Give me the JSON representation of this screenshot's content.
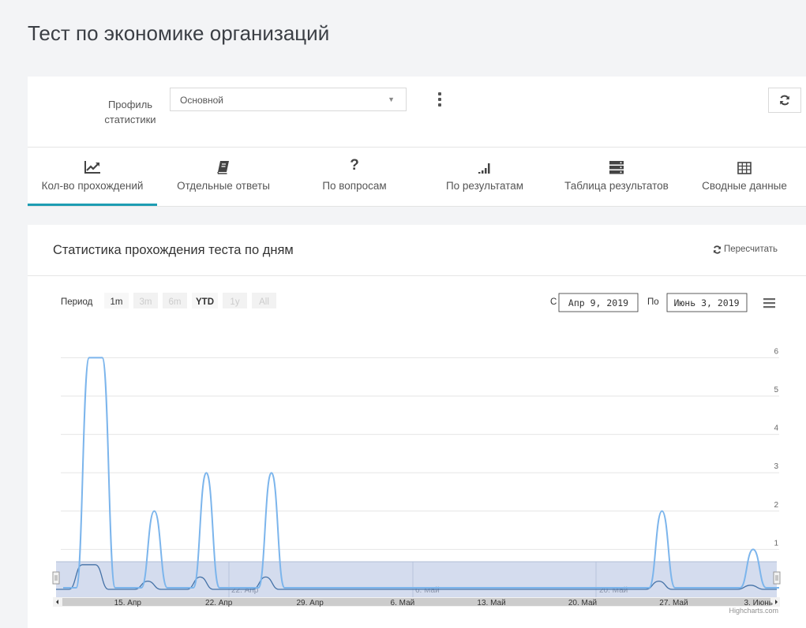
{
  "page": {
    "title": "Тест по экономике организаций"
  },
  "profile": {
    "label_line1": "Профиль",
    "label_line2": "статистики",
    "selected": "Основной"
  },
  "tabs": [
    {
      "label": "Кол-во прохождений",
      "icon": "line-chart-icon",
      "active": true
    },
    {
      "label": "Отдельные ответы",
      "icon": "book-icon",
      "active": false
    },
    {
      "label": "По вопросам",
      "icon": "question-icon",
      "active": false
    },
    {
      "label": "По результатам",
      "icon": "bar-signal-icon",
      "active": false
    },
    {
      "label": "Таблица результатов",
      "icon": "server-table-icon",
      "active": false
    },
    {
      "label": "Сводные данные",
      "icon": "grid-table-icon",
      "active": false
    }
  ],
  "stats": {
    "title": "Статистика прохождения теста по дням",
    "recalc_label": "Пересчитать"
  },
  "range_selector": {
    "period_label": "Период",
    "buttons": [
      {
        "label": "1m",
        "enabled": true
      },
      {
        "label": "3m",
        "enabled": false
      },
      {
        "label": "6m",
        "enabled": false
      },
      {
        "label": "YTD",
        "enabled": true
      },
      {
        "label": "1y",
        "enabled": false
      },
      {
        "label": "All",
        "enabled": false
      }
    ],
    "from_label": "С",
    "from_value": "Апр 9, 2019",
    "to_label": "По",
    "to_value": "Июнь 3, 2019"
  },
  "credits": "Highcharts.com",
  "colors": {
    "accent": "#1d9db3",
    "series": "#7cb5ec",
    "navigator_fill": "#ccd6eb",
    "navigator_line": "#4572a7"
  },
  "chart_data": {
    "type": "line",
    "x_range": [
      "2019-04-09",
      "2019-06-03"
    ],
    "y_ticks": [
      1,
      2,
      3,
      4,
      5,
      6
    ],
    "x_ticks": [
      "15. Апр",
      "22. Апр",
      "29. Апр",
      "6. Май",
      "13. Май",
      "20. Май",
      "27. Май",
      "3. Июнь"
    ],
    "navigator_labels": [
      "22. Апр",
      "6. Май",
      "20. Май"
    ],
    "points": [
      {
        "x": "2019-04-09",
        "y": 0
      },
      {
        "x": "2019-04-10",
        "y": 0
      },
      {
        "x": "2019-04-11",
        "y": 6
      },
      {
        "x": "2019-04-12",
        "y": 6
      },
      {
        "x": "2019-04-13",
        "y": 0
      },
      {
        "x": "2019-04-14",
        "y": 0
      },
      {
        "x": "2019-04-15",
        "y": 0
      },
      {
        "x": "2019-04-16",
        "y": 2
      },
      {
        "x": "2019-04-17",
        "y": 0
      },
      {
        "x": "2019-04-18",
        "y": 0
      },
      {
        "x": "2019-04-19",
        "y": 0
      },
      {
        "x": "2019-04-20",
        "y": 3
      },
      {
        "x": "2019-04-21",
        "y": 0
      },
      {
        "x": "2019-04-22",
        "y": 0
      },
      {
        "x": "2019-04-23",
        "y": 0
      },
      {
        "x": "2019-04-24",
        "y": 0
      },
      {
        "x": "2019-04-25",
        "y": 3
      },
      {
        "x": "2019-04-26",
        "y": 0
      },
      {
        "x": "2019-05-24",
        "y": 0
      },
      {
        "x": "2019-05-25",
        "y": 2
      },
      {
        "x": "2019-05-26",
        "y": 0
      },
      {
        "x": "2019-05-31",
        "y": 0
      },
      {
        "x": "2019-06-01",
        "y": 1
      },
      {
        "x": "2019-06-02",
        "y": 0
      },
      {
        "x": "2019-06-03",
        "y": 0
      }
    ]
  }
}
